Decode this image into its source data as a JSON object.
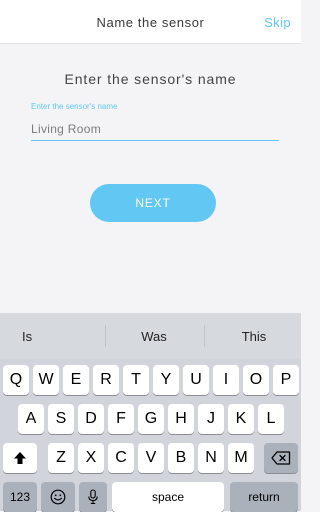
{
  "header": {
    "title": "Name the sensor",
    "skip_label": "Skip"
  },
  "form": {
    "prompt": "Enter the sensor's name",
    "field_label": "Enter the sensor's name",
    "field_value": "Living Room",
    "next_label": "NEXT"
  },
  "keyboard": {
    "suggestions": [
      "Is",
      "Was",
      "This"
    ],
    "row1": [
      "Q",
      "W",
      "E",
      "R",
      "T",
      "Y",
      "U",
      "I",
      "O",
      "P"
    ],
    "row2": [
      "A",
      "S",
      "D",
      "F",
      "G",
      "H",
      "J",
      "K",
      "L"
    ],
    "row3": [
      "Z",
      "X",
      "C",
      "V",
      "B",
      "N",
      "M"
    ],
    "shift_icon": "shift-arrow-icon",
    "backspace_icon": "backspace-icon",
    "numbers_label": "123",
    "emoji_icon": "emoji-icon",
    "mic_icon": "microphone-icon",
    "space_label": "space",
    "return_label": "return"
  },
  "colors": {
    "accent": "#62c7f3",
    "keyboard_bg": "#d1d4da",
    "key_bg": "#ffffff",
    "special_key_bg": "#abb1ba"
  }
}
